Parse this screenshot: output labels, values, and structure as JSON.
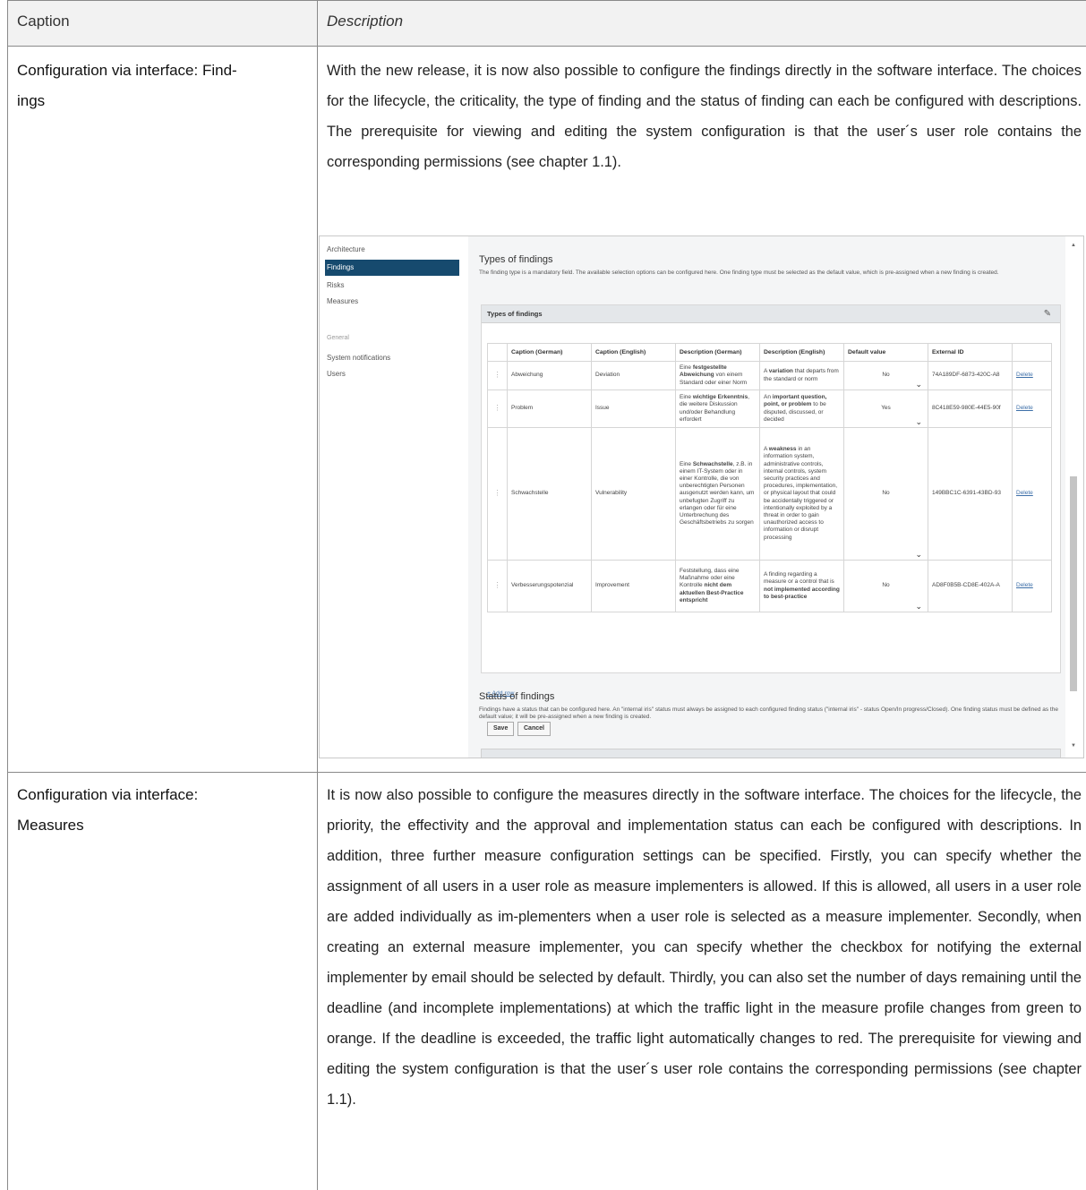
{
  "table_header": {
    "caption": "Caption",
    "description": "Description"
  },
  "row1": {
    "caption": "Configuration via interface: Find-ings",
    "description": "With the new release, it is now also possible to configure the findings directly in the software interface. The choices for the lifecycle, the criticality, the type of finding and the status of finding can each be configured with descriptions. The prerequisite for viewing and editing the system configuration is that the user´s user role contains the corresponding permissions (see chapter 1.1)."
  },
  "row2": {
    "caption": "Configuration via interface: Measures",
    "description": "It is now also possible to configure the measures directly in the software interface. The choices for the lifecycle, the priority, the effectivity and the approval and implementation status can each be configured with descriptions. In addition, three further measure configuration settings can be specified. Firstly, you can specify whether the assignment of all users in a user role as measure implementers is allowed. If this is allowed, all users in a user role are added individually as im-plementers when a user role is selected as a measure implementer. Secondly, when creating an external measure implementer, you can specify whether the checkbox for notifying the external implementer by email should be selected by default. Thirdly, you can also set the number of days remaining until the deadline (and incomplete implementations) at which the traffic light in the measure profile changes from green to orange. If the deadline is exceeded, the traffic light automatically changes to red. The prerequisite for viewing and editing the system configuration is that the user´s user role contains the corresponding permissions (see chapter 1.1)."
  },
  "screenshot": {
    "nav": {
      "items": [
        "Architecture",
        "Findings",
        "Risks",
        "Measures"
      ],
      "group_label": "General",
      "general_items": [
        "System notifications",
        "Users"
      ]
    },
    "section1": {
      "title": "Types of findings",
      "description": "The finding type is a mandatory field. The available selection options can be configured here. One finding type must be selected as the default value, which is pre-assigned when a new finding is created."
    },
    "panel_title": "Types of findings",
    "columns": [
      "Caption (German)",
      "Caption (English)",
      "Description (German)",
      "Description (English)",
      "Default value",
      "External ID"
    ],
    "rows": [
      {
        "caption_de": "Abweichung",
        "caption_en": "Deviation",
        "desc_de_pre": "Eine ",
        "desc_de_bold": "festgestellte Abweichung",
        "desc_de_post": " von einem Standard oder einer Norm",
        "desc_en_pre": "A ",
        "desc_en_bold": "variation",
        "desc_en_post": " that departs from the standard or norm",
        "default": "No",
        "external_id": "74A189DF-6873-420C-A8",
        "action": "Delete"
      },
      {
        "caption_de": "Problem",
        "caption_en": "Issue",
        "desc_de_pre": "Eine ",
        "desc_de_bold": "wichtige Erkenntnis",
        "desc_de_post": ", die weitere Diskussion und/oder Behandlung erfordert",
        "desc_en_pre": "An ",
        "desc_en_bold": "important question, point, or problem",
        "desc_en_post": " to be disputed, discussed, or decided",
        "default": "Yes",
        "external_id": "8C418E59-980E-44E5-90f",
        "action": "Delete"
      },
      {
        "caption_de": "Schwachstelle",
        "caption_en": "Vulnerability",
        "desc_de_pre": "Eine ",
        "desc_de_bold": "Schwachstelle",
        "desc_de_post": ", z.B. in einem IT-System oder in einer Kontrolle, die von unberechtigten Personen ausgenutzt werden kann, um unbefugten Zugriff zu erlangen oder für eine Unterbrechung des Geschäftsbetriebs zu sorgen",
        "desc_en_pre": "A ",
        "desc_en_bold": "weakness",
        "desc_en_post": " in an information system, administrative controls, internal controls, system security practices and procedures, implementation, or physical layout that could be accidentally triggered or intentionally exploited by a threat in order to gain unauthorized access to information or disrupt processing",
        "default": "No",
        "external_id": "149BBC1C-6391-43BD-93",
        "action": "Delete"
      },
      {
        "caption_de": "Verbesserungspotenzial",
        "caption_en": "Improvement",
        "desc_de_pre": "Feststellung, dass eine Maßnahme oder eine Kontrolle ",
        "desc_de_bold": "nicht dem aktuellen Best-Practice entspricht",
        "desc_de_post": "",
        "desc_en_pre": "A finding regarding a measure or a control that is ",
        "desc_en_bold": "not implemented according to best-practice",
        "desc_en_post": "",
        "default": "No",
        "external_id": "AD8F0B5B-CD8E-402A-A",
        "action": "Delete"
      }
    ],
    "add_row": "+ Add row",
    "save": "Save",
    "cancel": "Cancel",
    "section2": {
      "title": "Status of findings",
      "description": "Findings have a status that can be configured here. An \"internal iris\" status must always be assigned to each configured finding status (\"internal iris\" - status Open/In progress/Closed). One finding status must be defined as the default value; it will be pre-assigned when a new finding is created."
    }
  }
}
